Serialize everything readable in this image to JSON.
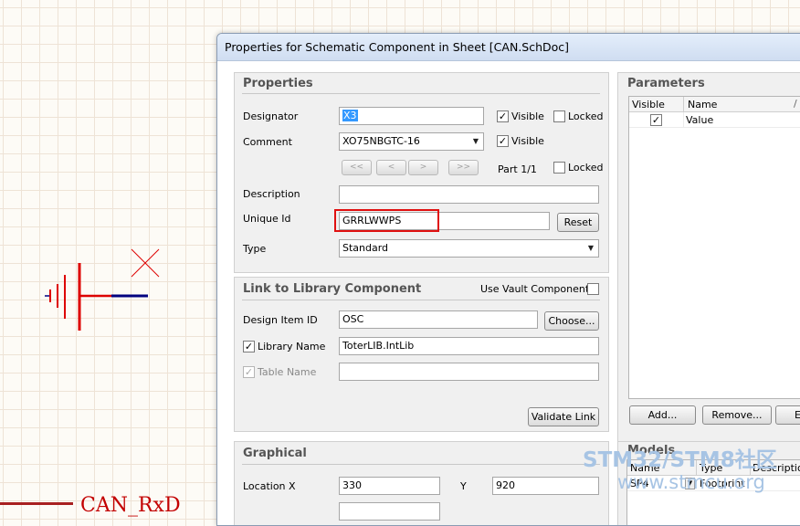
{
  "canvas": {
    "bottom_text": "CAN_RxD"
  },
  "dialog": {
    "title": "Properties for Schematic Component in Sheet [CAN.SchDoc]"
  },
  "properties": {
    "title": "Properties",
    "designator": {
      "label": "Designator",
      "value": "X3"
    },
    "comment": {
      "label": "Comment",
      "value": "XO75NBGTC-16"
    },
    "visible_label": "Visible",
    "locked_label": "Locked",
    "nav": [
      "<<",
      "<",
      ">",
      ">>"
    ],
    "part": "Part 1/1",
    "description": {
      "label": "Description",
      "value": ""
    },
    "unique_id": {
      "label": "Unique Id",
      "value": "GRRLWWPS"
    },
    "reset_label": "Reset",
    "type": {
      "label": "Type",
      "value": "Standard"
    }
  },
  "link": {
    "title": "Link to Library Component",
    "use_vault_label": "Use Vault Component",
    "design_item_id": {
      "label": "Design Item ID",
      "value": "OSC"
    },
    "choose_label": "Choose...",
    "library_name": {
      "label": "Library Name",
      "value": "ToterLIB.IntLib"
    },
    "table_name": {
      "label": "Table Name",
      "value": ""
    },
    "validate_label": "Validate Link"
  },
  "graphical": {
    "title": "Graphical",
    "location_label": "Location  X",
    "x_value": "330",
    "y_label": "Y",
    "y_value": "920"
  },
  "parameters": {
    "title": "Parameters",
    "columns": [
      "Visible",
      "Name"
    ],
    "sort_glyph": "/",
    "rows": [
      {
        "visible": true,
        "name": "Value"
      }
    ],
    "add_label": "Add...",
    "remove_label": "Remove...",
    "edit_label": "E"
  },
  "models": {
    "title": "Models",
    "columns": [
      "Name",
      "Type",
      "Description"
    ],
    "rows": [
      {
        "name": "SP4",
        "type": "Footprint"
      }
    ]
  },
  "watermark": {
    "line1": "STM32/STM8社区",
    "line2": "www.stmcu.org"
  },
  "colors": {
    "schematic_red": "#dd0000",
    "wire_blue": "#000080",
    "highlight_box": "#e01010"
  }
}
